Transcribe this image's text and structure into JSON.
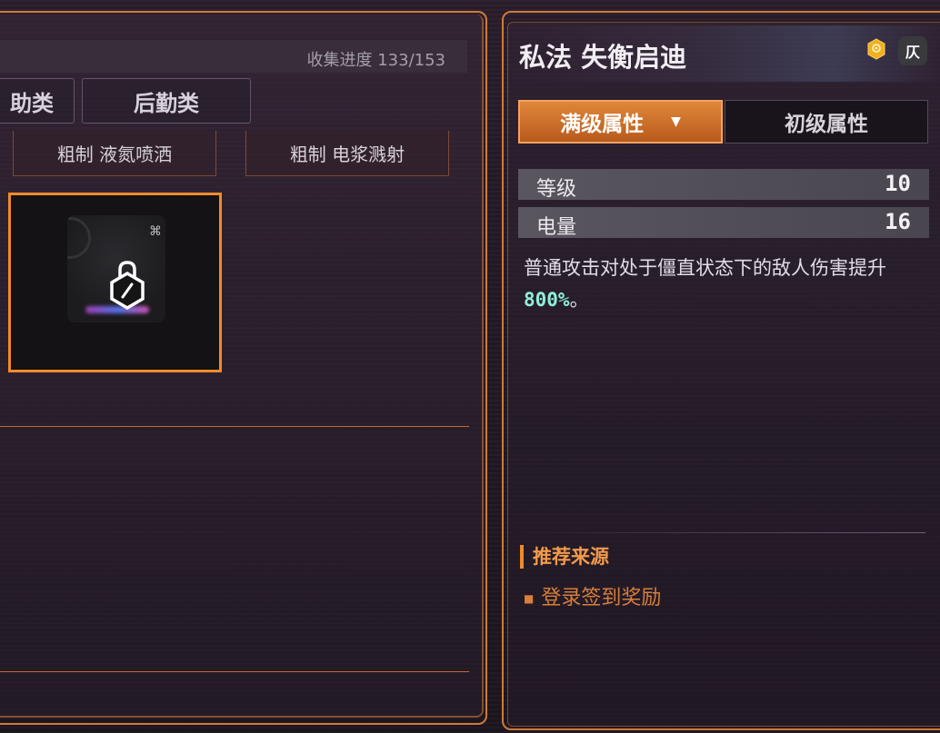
{
  "collection": {
    "progress_label": "收集进度 133/153"
  },
  "category_tabs": [
    {
      "label": "助类"
    },
    {
      "label": "后勤类"
    }
  ],
  "sub_tabs": [
    {
      "label": "粗制 液氮喷洒"
    },
    {
      "label": "粗制 电浆溅射"
    }
  ],
  "item_card": {
    "lock_icon": "hexagon-lock-icon",
    "corner_icon": "chip-icon"
  },
  "detail": {
    "title": "私法 失衡启迪",
    "badge_icon": "gold-rank-badge-icon",
    "type_icon_text": "仄",
    "tabs": [
      {
        "label": "满级属性",
        "active": true
      },
      {
        "label": "初级属性",
        "active": false
      }
    ],
    "stats": [
      {
        "label": "等级",
        "value": "10"
      },
      {
        "label": "电量",
        "value": "16"
      }
    ],
    "description_before": "普通攻击对处于僵直状态下的敌人伤害提升",
    "description_highlight": "800%",
    "description_after": "。",
    "source_title": "推荐来源",
    "source_items": [
      "登录签到奖励"
    ]
  },
  "colors": {
    "accent_orange": "#f08a2a",
    "highlight_teal": "#8ff0d6",
    "panel_border": "#d07a36"
  }
}
